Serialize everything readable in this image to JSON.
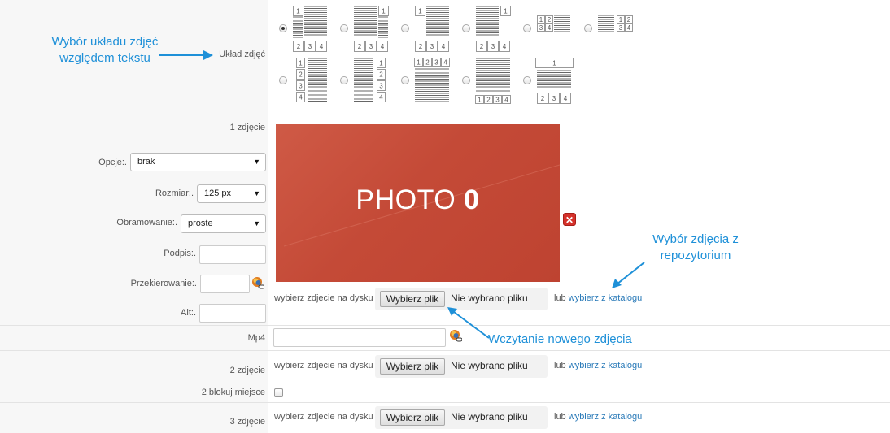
{
  "layout_section": {
    "label": "Układ zdjęć",
    "selected_index": 0,
    "options_count": 12
  },
  "annotations": {
    "layout": "Wybór układu zdjęć względem tekstu",
    "repo": "Wybór zdjęcia z repozytorium",
    "upload": "Wczytanie nowego zdjęcia"
  },
  "photo1": {
    "label": "1 zdjęcie",
    "preview_text": "PHOTO",
    "preview_number": "0",
    "opcje_label": "Opcje:.",
    "opcje_value": "brak",
    "rozmiar_label": "Rozmiar:.",
    "rozmiar_value": "125 px",
    "obramowanie_label": "Obramowanie:.",
    "obramowanie_value": "proste",
    "podpis_label": "Podpis:.",
    "przekierowanie_label": "Przekierowanie:.",
    "alt_label": "Alt:."
  },
  "upload": {
    "disk_label": "wybierz zdjecie na dysku",
    "button": "Wybierz plik",
    "status": "Nie wybrano pliku",
    "or": "lub",
    "catalog_link": "wybierz z katalogu"
  },
  "mp4": {
    "label": "Mp4"
  },
  "photo2": {
    "label": "2 zdjęcie"
  },
  "block": {
    "label": "2 blokuj miejsce"
  },
  "photo3": {
    "label": "3 zdjęcie"
  },
  "colors": {
    "accent": "#1e90d8",
    "link": "#2a7ab8",
    "photo_bg": "#c44a37",
    "delete": "#d5322b"
  }
}
